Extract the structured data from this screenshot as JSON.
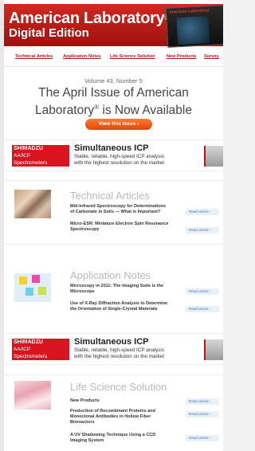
{
  "header": {
    "brand_line1": "American Laboratory",
    "reg_mark": "®",
    "brand_line2": "Digital Edition",
    "cover_text": "American Laboratory"
  },
  "nav": [
    {
      "label": "Technical Articles"
    },
    {
      "label": "Application Notes"
    },
    {
      "label": "Life Science Solution"
    },
    {
      "label": "New Products"
    },
    {
      "label": "Survey"
    }
  ],
  "issue": {
    "volume": "Volume 43, Number 5",
    "headline_line1": "The April Issue of American",
    "headline_line2_a": "Laboratory",
    "headline_reg": "®",
    "headline_line2_b": " is Now Available",
    "button": "View this issue ›"
  },
  "ad": {
    "brand": "SHIMADZU",
    "tag1": "AA/ICP",
    "tag2": "Spectrometers",
    "title": "Simultaneous ICP",
    "desc_line1": "Stable, reliable, high-speed ICP analysis",
    "desc_line2": "with the highest resolution on the market"
  },
  "technical_articles": {
    "title": "Technical Articles",
    "items": [
      {
        "line1": "Mid-Infrared Spectroscopy for Determinations",
        "line2": "of Carbonate in Soils — What is Important?",
        "link": "Read article ›"
      },
      {
        "line1": "Micro-ESR: Miniature Electron Spin Resonance",
        "line2": "Spectroscopy",
        "link": "Read article ›"
      }
    ]
  },
  "application_notes": {
    "title": "Application Notes",
    "items": [
      {
        "line1": "Microscopy in 2011: The Imaging Suite is the",
        "line2": "Microscope",
        "link": "Read article ›"
      },
      {
        "line1": "Use of X-Ray Diffraction Analysis to Determine",
        "line2": "the Orientation of Single-Crystal Materials",
        "link": "Read article ›"
      }
    ]
  },
  "life_science": {
    "title": "Life Science Solution",
    "items": [
      {
        "line1": "New Products",
        "line2": "",
        "link": "Read article ›"
      },
      {
        "line1": "Production of Recombinant Proteins and",
        "line2": "Monoclonal Antibodies in Hollow Fiber",
        "line3": "Bioreactors",
        "link": "Read article ›"
      },
      {
        "line1": "A UV Shadowing Technique Using a CCD",
        "line2": "Imaging System",
        "link": "Read article ›"
      }
    ]
  },
  "colors": {
    "brand_red": "#c41e1a",
    "link_blue": "#3e7cbf",
    "button_orange": "#f26522"
  }
}
